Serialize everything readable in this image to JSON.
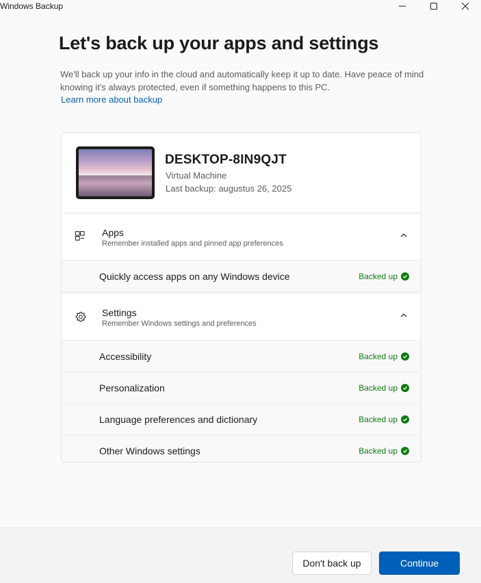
{
  "window": {
    "title": "Windows Backup"
  },
  "page": {
    "heading": "Let's back up your apps and settings",
    "description": "We'll back up your info in the cloud and automatically keep it up to date. Have peace of mind knowing it's always protected, even if something happens to this PC.",
    "learn_more": "Learn more about backup"
  },
  "device": {
    "name": "DESKTOP-8IN9QJT",
    "type": "Virtual Machine",
    "last_backup": "Last backup: augustus 26, 2025"
  },
  "sections": {
    "apps": {
      "title": "Apps",
      "subtitle": "Remember installed apps and pinned app preferences",
      "items": [
        {
          "label": "Quickly access apps on any Windows device",
          "status": "Backed up"
        }
      ]
    },
    "settings": {
      "title": "Settings",
      "subtitle": "Remember Windows settings and preferences",
      "items": [
        {
          "label": "Accessibility",
          "status": "Backed up"
        },
        {
          "label": "Personalization",
          "status": "Backed up"
        },
        {
          "label": "Language preferences and dictionary",
          "status": "Backed up"
        },
        {
          "label": "Other Windows settings",
          "status": "Backed up"
        }
      ]
    }
  },
  "footer": {
    "dont_backup": "Don't back up",
    "continue": "Continue"
  },
  "colors": {
    "accent": "#005fb8",
    "success": "#0f7b0f",
    "link": "#0a5fb4"
  },
  "icons": {
    "minimize": "minimize-icon",
    "maximize": "maximize-icon",
    "close": "close-icon",
    "apps": "apps-icon",
    "settings": "gear-icon",
    "chevron": "chevron-up-icon",
    "status": "check-circle-icon"
  }
}
